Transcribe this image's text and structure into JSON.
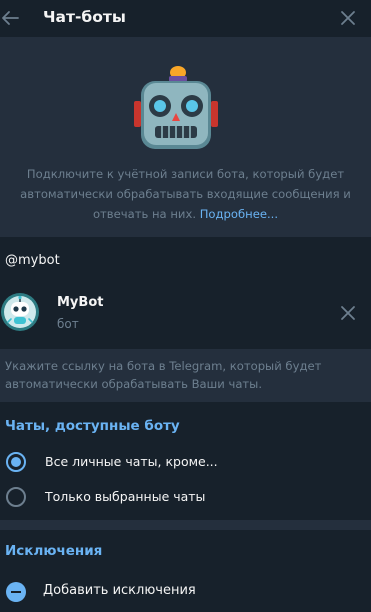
{
  "header": {
    "title": "Чат-боты"
  },
  "hero": {
    "description": "Подключите к учётной записи бота, который будет автоматически обрабатывать входящие сообщения и отвечать на них.",
    "link_label": "Подробнее..."
  },
  "bot_search": {
    "value": "@mybot"
  },
  "bot": {
    "name": "MyBot",
    "subtitle": "бот"
  },
  "hint": {
    "text": "Укажите ссылку на бота в Telegram, который будет автоматически обрабатывать Ваши чаты."
  },
  "chats_section": {
    "title": "Чаты, доступные боту",
    "options": [
      {
        "label": "Все личные чаты, кроме...",
        "selected": true
      },
      {
        "label": "Только выбранные чаты",
        "selected": false
      }
    ]
  },
  "exceptions_section": {
    "title": "Исключения",
    "add_label": "Добавить исключения"
  },
  "colors": {
    "background": "#17212b",
    "panel": "#242f3d",
    "accent": "#6ab3f3",
    "muted_text": "#6d7f8f",
    "text": "#f5f5f5"
  }
}
